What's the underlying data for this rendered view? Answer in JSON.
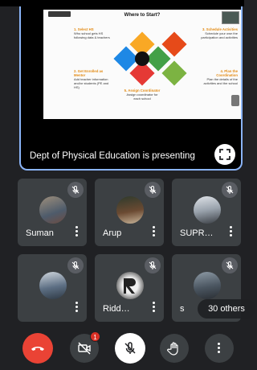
{
  "presentation": {
    "slide_title": "Where to Start?",
    "steps": [
      {
        "title": "1. Select HS",
        "text": "Who school gets HS following data & teachers"
      },
      {
        "title": "2. Get Enrolled as Mentor",
        "text": "Add teacher information and/or students (PE and HS)"
      },
      {
        "title": "3. Schedule Activities",
        "text": "Schedule your own the participation and activities"
      },
      {
        "title": "4. Plan the Coordination",
        "text": "Plan the details of the activities and the school"
      },
      {
        "title": "5. Assign Coordinator",
        "text": "Assign coordinator for each school"
      }
    ],
    "presenting_label": "Dept of Physical Education is presenting"
  },
  "participants": [
    {
      "name": "Suman"
    },
    {
      "name": "Arup"
    },
    {
      "name": "SUPR…"
    },
    {
      "name": ""
    },
    {
      "name": "Ridd…"
    },
    {
      "name": "s"
    }
  ],
  "others_label": "30 others",
  "controls": {
    "camera_badge": "1"
  },
  "colors": {
    "background": "#202124",
    "tile": "#3c4043",
    "end_call": "#ea4335",
    "accent_border": "#8ab4f8"
  }
}
